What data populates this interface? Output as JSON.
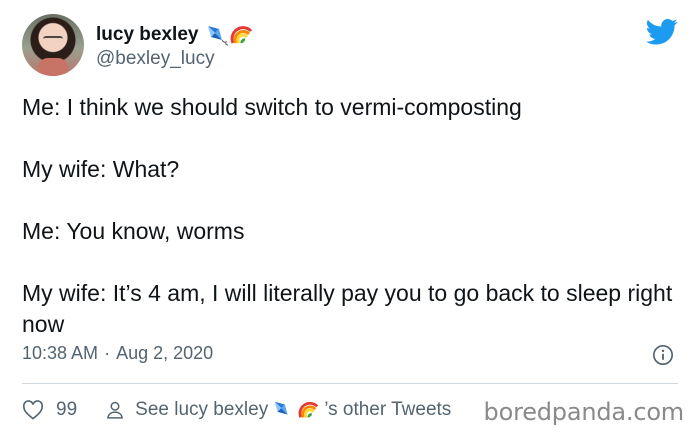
{
  "user": {
    "display_name": "lucy bexley",
    "handle": "@bexley_lucy",
    "emojis": [
      "kite-icon",
      "rainbow-icon"
    ]
  },
  "tweet": {
    "lines": [
      "Me: I think we should switch to vermi-composting",
      "My wife: What?",
      "Me: You know, worms",
      "My wife: It’s 4 am, I will literally pay you to go back to sleep right now"
    ],
    "time": "10:38 AM",
    "separator": "·",
    "date": "Aug 2, 2020"
  },
  "actions": {
    "like_count": "99",
    "see_prefix": "See lucy bexley",
    "see_suffix": "’s other Tweets"
  },
  "watermark": "boredpanda.com",
  "colors": {
    "twitter_blue": "#1d9bf0",
    "secondary_text": "#536471",
    "divider": "#cfd9de"
  }
}
